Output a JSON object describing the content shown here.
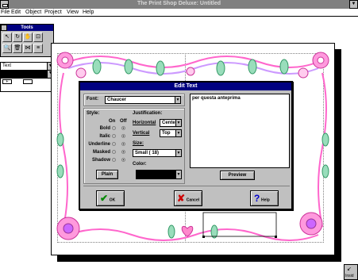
{
  "window": {
    "title": "The Print Shop Deluxe: Untitled"
  },
  "menu": [
    "File",
    "Edit",
    "Object",
    "Project",
    "View",
    "Help"
  ],
  "tools_panel": {
    "title": "Tools"
  },
  "text_panel": {
    "style_label": "Text"
  },
  "dialog": {
    "title": "Edit Text",
    "font_label": "Font:",
    "font_value": "Chaucer",
    "style_label": "Style:",
    "on_label": "On",
    "off_label": "Off",
    "styles": [
      "Bold",
      "Italic",
      "Underline",
      "Masked",
      "Shadow"
    ],
    "justification_label": "Justification:",
    "horizontal_label": "Horizontal",
    "horizontal_value": "Center",
    "vertical_label": "Vertical",
    "vertical_value": "Top",
    "size_label": "Size:",
    "size_value": "Small ( 18)",
    "color_label": "Color:",
    "plain_button": "Plain",
    "preview_button": "Preview",
    "text_content": "per questa anteprima",
    "ok_button": "OK",
    "cancel_button": "Cancel",
    "help_button": "Help"
  },
  "corner_label": "Insid",
  "colors": {
    "titlebar": "#000080",
    "face": "#c0c0c0",
    "border_pink": "#ff66cc",
    "border_green": "#66cc99",
    "border_purple": "#9966cc"
  }
}
